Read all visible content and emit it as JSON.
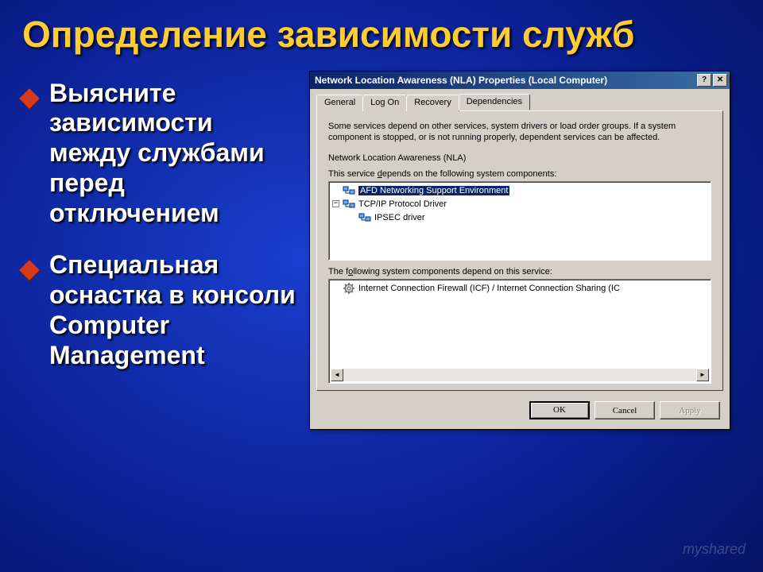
{
  "slide": {
    "title": "Определение зависимости служб",
    "bullets": [
      "Выясните зависимости между службами перед отключением",
      "Специальная оснастка в консоли Computer Management"
    ]
  },
  "dialog": {
    "title": "Network Location Awareness (NLA) Properties (Local Computer)",
    "tabs": [
      "General",
      "Log On",
      "Recovery",
      "Dependencies"
    ],
    "activeTab": 3,
    "description": "Some services depend on other services, system drivers or load order groups. If a system component is stopped, or is not running properly, dependent services can be affected.",
    "serviceName": "Network Location Awareness (NLA)",
    "label_depends_on": "This service depends on the following system components:",
    "depends_tree": [
      {
        "label": "AFD Networking Support Environment",
        "expand": "",
        "indent": 0,
        "icon": "net",
        "selected": true
      },
      {
        "label": "TCP/IP Protocol Driver",
        "expand": "-",
        "indent": 0,
        "icon": "net",
        "selected": false
      },
      {
        "label": "IPSEC driver",
        "expand": "",
        "indent": 1,
        "icon": "net",
        "selected": false
      }
    ],
    "label_dependents": "The following system components depend on this service:",
    "dependents_tree": [
      {
        "label": "Internet Connection Firewall (ICF) / Internet Connection Sharing (IC",
        "icon": "gear"
      }
    ],
    "buttons": {
      "ok": "OK",
      "cancel": "Cancel",
      "apply": "Apply"
    }
  },
  "watermark": "myshared"
}
